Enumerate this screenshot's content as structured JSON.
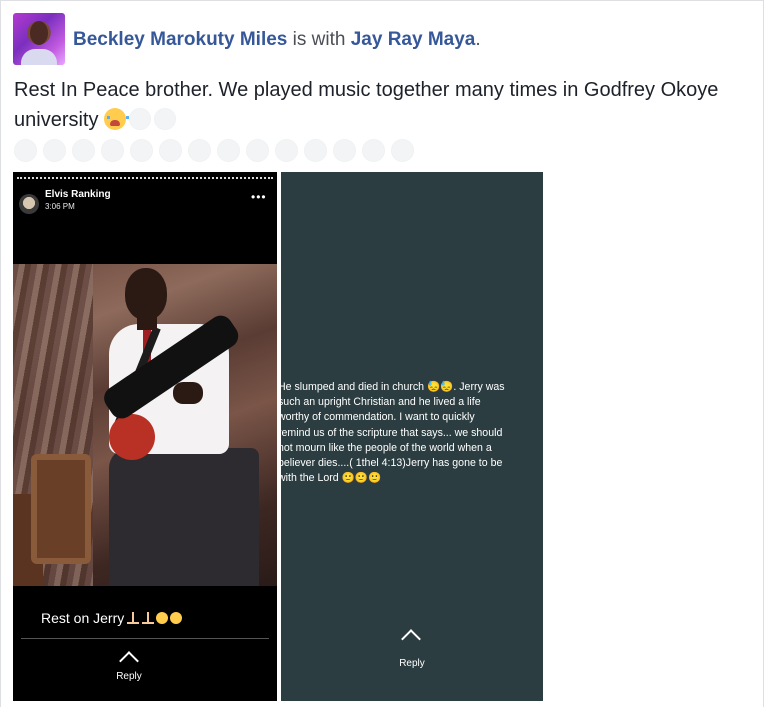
{
  "post": {
    "author": "Beckley Marokuty Miles",
    "with_text": " is with ",
    "tagged": "Jay Ray Maya",
    "period": ".",
    "text": "Rest In Peace brother. We played music together many times in Godfrey Okoye university",
    "emoji_icon": "loudly-crying-face-icon"
  },
  "story_left": {
    "username": "Elvis Ranking",
    "time": "3:06 PM",
    "more": "•••",
    "caption": "Rest on Jerry",
    "reply_label": "Reply"
  },
  "story_right": {
    "text": "He slumped and died in church 😓😓. Jerry was\nsuch an upright Christian and he lived a life\nworthy of commendation. I want to quickly\nremind us of the scripture that says... we should\nnot mourn like the people of the world when a\nbeliever dies....( 1thel 4:13)Jerry has gone to be\nwith the Lord 🙂🙂🙂",
    "reply_label": "Reply"
  },
  "colors": {
    "link": "#365899",
    "right_bg": "#2b3d40"
  }
}
